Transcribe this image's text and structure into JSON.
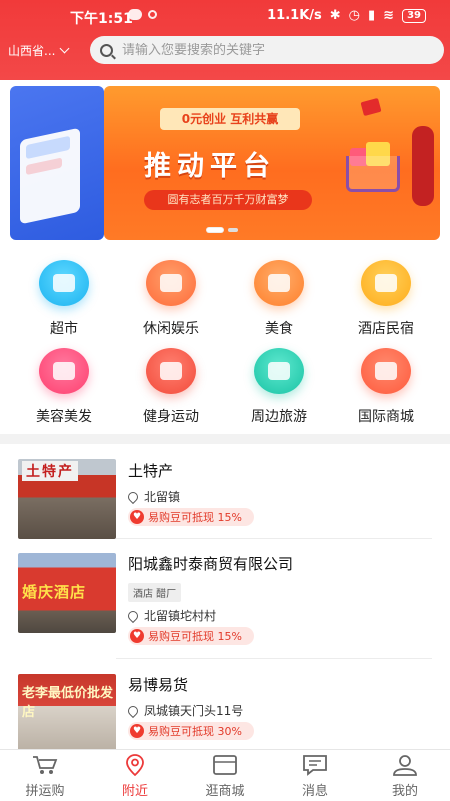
{
  "status_bar": {
    "time": "下午1:51",
    "speed": "11.1K/s",
    "battery": "39"
  },
  "header": {
    "location": "山西省...",
    "search_placeholder": "请输入您要搜索的关键字"
  },
  "banner": {
    "tag": "0元创业  互利共赢",
    "title": "推动平台",
    "subtitle": "圆有志者百万千万财富梦"
  },
  "categories": [
    {
      "label": "超市",
      "icon": "supermarket-icon",
      "color": "#1ab3f0"
    },
    {
      "label": "休闲娱乐",
      "icon": "game-icon",
      "color": "#ff6b3a"
    },
    {
      "label": "美食",
      "icon": "food-icon",
      "color": "#ff7f2a"
    },
    {
      "label": "酒店民宿",
      "icon": "hotel-icon",
      "color": "#ffac1a"
    },
    {
      "label": "美容美发",
      "icon": "beauty-icon",
      "color": "#ff3f6f"
    },
    {
      "label": "健身运动",
      "icon": "dumbbell-icon",
      "color": "#f24a3a"
    },
    {
      "label": "周边旅游",
      "icon": "palm-tree-icon",
      "color": "#18c3a4"
    },
    {
      "label": "国际商城",
      "icon": "shopping-bag-icon",
      "color": "#ff5a3c"
    }
  ],
  "list": [
    {
      "title": "土特产",
      "thumb_text": "土特产",
      "tag": "",
      "address": "北留镇",
      "promo": "易购豆可抵现 15%"
    },
    {
      "title": "阳城鑫时泰商贸有限公司",
      "thumb_text": "婚庆酒店",
      "tag": "酒店 醋厂",
      "address": "北留镇坨村村",
      "promo": "易购豆可抵现 15%"
    },
    {
      "title": "易博易货",
      "thumb_text": "老李最低价批发店",
      "tag": "",
      "address": "凤城镇天门头11号",
      "promo": "易购豆可抵现 30%"
    }
  ],
  "bottom_nav": [
    {
      "label": "拼运购",
      "icon": "cart-icon",
      "active": false
    },
    {
      "label": "附近",
      "icon": "location-pin-icon",
      "active": true
    },
    {
      "label": "逛商城",
      "icon": "mall-icon",
      "active": false
    },
    {
      "label": "消息",
      "icon": "message-icon",
      "active": false
    },
    {
      "label": "我的",
      "icon": "profile-icon",
      "active": false
    }
  ],
  "colors": {
    "brand_red": "#f13a3a",
    "active_nav": "#ec3a3a",
    "promo_text": "#e23a2a"
  }
}
